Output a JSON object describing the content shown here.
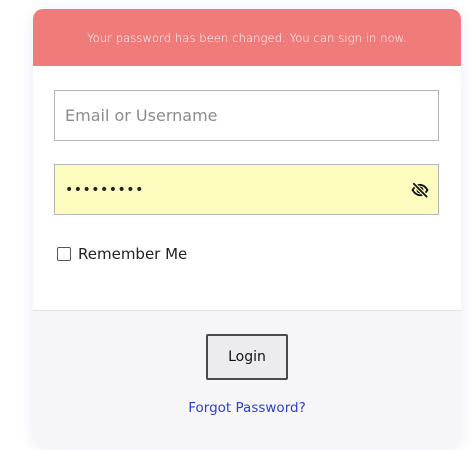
{
  "alert": {
    "message": "Your password has been changed. You can sign in now.",
    "background": "#ef7b7b"
  },
  "form": {
    "email": {
      "placeholder": "Email or Username",
      "value": ""
    },
    "password": {
      "value": "•••••••••",
      "background": "#fcfcbf",
      "toggle_icon": "eye-slash-icon"
    },
    "remember": {
      "label": "Remember Me",
      "checked": false
    }
  },
  "actions": {
    "login_label": "Login",
    "forgot_label": "Forgot Password?",
    "link_color": "#2c3fd1"
  }
}
